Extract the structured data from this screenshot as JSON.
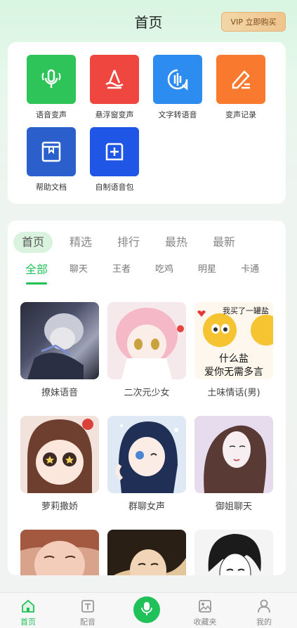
{
  "header": {
    "title": "首页",
    "vip_label": "VIP 立即购买"
  },
  "tools": [
    {
      "label": "语音变声",
      "icon": "mic-waves-icon",
      "color": "#2fc45a"
    },
    {
      "label": "悬浮窗变声",
      "icon": "floating-window-icon",
      "color": "#f04640"
    },
    {
      "label": "文字转语音",
      "icon": "text-to-speech-icon",
      "color": "#2d8cf0"
    },
    {
      "label": "变声记录",
      "icon": "pencil-record-icon",
      "color": "#f97a2e"
    },
    {
      "label": "帮助文档",
      "icon": "help-book-icon",
      "color": "#2b5fcc"
    },
    {
      "label": "自制语音包",
      "icon": "add-square-icon",
      "color": "#1f56e6"
    }
  ],
  "tabs": [
    "首页",
    "精选",
    "排行",
    "最热",
    "最新"
  ],
  "active_tab": "首页",
  "subtabs": [
    "全部",
    "聊天",
    "王者",
    "吃鸡",
    "明星",
    "卡通"
  ],
  "active_subtab": "全部",
  "voices": [
    {
      "label": "撩妹语音"
    },
    {
      "label": "二次元少女"
    },
    {
      "label": "土味情话(男)",
      "overlay_top": "我买了一罐盐",
      "overlay_mid": "什么盐",
      "overlay_bottom": "爱你无需多言"
    },
    {
      "label": "萝莉撒娇"
    },
    {
      "label": "群聊女声"
    },
    {
      "label": "御姐聊天"
    },
    {
      "label": ""
    },
    {
      "label": ""
    },
    {
      "label": ""
    }
  ],
  "bottom_nav": [
    {
      "label": "首页",
      "icon": "home-icon"
    },
    {
      "label": "配音",
      "icon": "dubbing-icon"
    },
    {
      "label": "",
      "icon": "mic-icon"
    },
    {
      "label": "收藏夹",
      "icon": "favorites-icon"
    },
    {
      "label": "我的",
      "icon": "profile-icon"
    }
  ],
  "colors": {
    "accent": "#21c15a"
  }
}
